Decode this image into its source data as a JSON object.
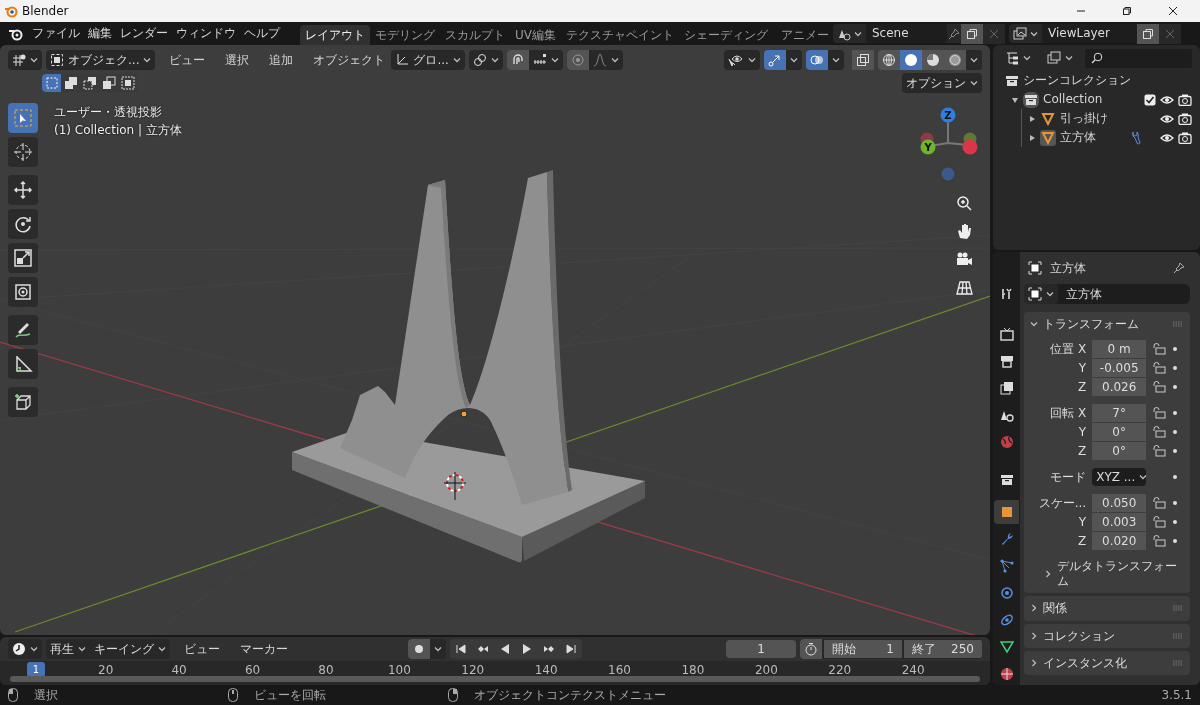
{
  "window": {
    "title": "Blender"
  },
  "menu": [
    "ファイル",
    "編集",
    "レンダー",
    "ウィンドウ",
    "ヘルプ"
  ],
  "workspaces": [
    {
      "label": "レイアウト",
      "selected": true
    },
    {
      "label": "モデリング",
      "selected": false
    },
    {
      "label": "スカルプト",
      "selected": false
    },
    {
      "label": "UV編集",
      "selected": false
    },
    {
      "label": "テクスチャペイント",
      "selected": false
    },
    {
      "label": "シェーディング",
      "selected": false
    },
    {
      "label": "アニメー",
      "selected": false
    }
  ],
  "scene": "Scene",
  "view_layer": "ViewLayer",
  "viewport": {
    "mode": "オブジェク...",
    "menus": [
      "ビュー",
      "選択",
      "追加",
      "オブジェクト"
    ],
    "orientation": "グロ...",
    "gizmos_on": true,
    "overlays_on": true,
    "shading": [
      {
        "kind": "wire",
        "selected": false
      },
      {
        "kind": "solid",
        "selected": true
      },
      {
        "kind": "material",
        "selected": false
      },
      {
        "kind": "rendered",
        "selected": false
      }
    ],
    "select_modes": [
      {
        "kind": "new",
        "selected": true
      },
      {
        "kind": "extend",
        "selected": false
      },
      {
        "kind": "subtract",
        "selected": false
      },
      {
        "kind": "invert",
        "selected": false
      },
      {
        "kind": "intersect",
        "selected": false
      }
    ],
    "options": "オプション",
    "view_name": "ユーザー・透視投影",
    "view_info": "(1) Collection | 立方体",
    "tools": [
      [
        {
          "kind": "select",
          "selected": true
        },
        {
          "kind": "cursor",
          "selected": false
        }
      ],
      [
        {
          "kind": "move",
          "selected": false
        },
        {
          "kind": "rotate",
          "selected": false
        },
        {
          "kind": "scale",
          "selected": false
        },
        {
          "kind": "transform",
          "selected": false
        }
      ],
      [
        {
          "kind": "annotate",
          "selected": false
        },
        {
          "kind": "measure",
          "selected": false
        }
      ],
      [
        {
          "kind": "add_cube",
          "selected": false
        }
      ]
    ],
    "gizmo": {
      "z": "Z",
      "y": "Y"
    }
  },
  "outliner": {
    "root": "シーンコレクション",
    "collection": {
      "label": "Collection",
      "expanded": true,
      "checked": true,
      "active": true,
      "children": [
        {
          "label": "引っ掛け",
          "expanded": false,
          "selected": false,
          "modifier": false
        },
        {
          "label": "立方体",
          "expanded": false,
          "selected": true,
          "modifier": true
        }
      ]
    }
  },
  "properties": {
    "tabs": [
      [
        {
          "kind": "tool",
          "selected": false
        }
      ],
      [
        {
          "kind": "render",
          "selected": false
        },
        {
          "kind": "output",
          "selected": false
        },
        {
          "kind": "view_layer",
          "selected": false
        },
        {
          "kind": "scene",
          "selected": false
        },
        {
          "kind": "world",
          "selected": false
        }
      ],
      [
        {
          "kind": "collection",
          "selected": false
        }
      ],
      [
        {
          "kind": "object",
          "selected": true
        },
        {
          "kind": "modifier",
          "selected": false
        },
        {
          "kind": "particles",
          "selected": false
        },
        {
          "kind": "physics",
          "selected": false
        },
        {
          "kind": "constraints",
          "selected": false
        },
        {
          "kind": "data",
          "selected": false
        },
        {
          "kind": "material",
          "selected": false
        }
      ]
    ],
    "object": "立方体",
    "name": "立方体",
    "transform": {
      "title": "トランスフォーム",
      "expanded": true,
      "groups": [
        [
          {
            "kind": "number",
            "label": "位置 X",
            "value": "0 m"
          },
          {
            "kind": "number",
            "label": "Y",
            "value": "-0.005"
          },
          {
            "kind": "number",
            "label": "Z",
            "value": "0.026"
          }
        ],
        [
          {
            "kind": "number",
            "label": "回転 X",
            "value": "7°"
          },
          {
            "kind": "number",
            "label": "Y",
            "value": "0°"
          },
          {
            "kind": "number",
            "label": "Z",
            "value": "0°"
          }
        ],
        [
          {
            "kind": "dropdown",
            "label": "モード",
            "value": "XYZ ..."
          }
        ],
        [
          {
            "kind": "number",
            "label": "スケー...",
            "value": "0.050"
          },
          {
            "kind": "number",
            "label": "Y",
            "value": "0.003"
          },
          {
            "kind": "number",
            "label": "Z",
            "value": "0.020"
          }
        ]
      ],
      "sub": {
        "title": "デルタトランスフォーム",
        "expanded": false
      }
    },
    "panels": [
      {
        "title": "関係",
        "expanded": false
      },
      {
        "title": "コレクション",
        "expanded": false
      },
      {
        "title": "インスタンス化",
        "expanded": false
      }
    ]
  },
  "timeline": {
    "menus": [
      {
        "label": "再生",
        "dropdown": true
      },
      {
        "label": "キーイング",
        "dropdown": true
      },
      {
        "label": "ビュー",
        "dropdown": false
      },
      {
        "label": "マーカー",
        "dropdown": false
      }
    ],
    "current_frame": "1",
    "start_label": "開始",
    "start": "1",
    "end_label": "終了",
    "end": "250",
    "playhead": "1",
    "ruler": [
      "20",
      "40",
      "60",
      "80",
      "100",
      "120",
      "140",
      "160",
      "180",
      "200",
      "220",
      "240"
    ]
  },
  "status": {
    "items": [
      {
        "kind": "left_click",
        "text": "選択"
      },
      {
        "kind": "middle_click",
        "text": "ビューを回転"
      },
      {
        "kind": "right_click",
        "text": "オブジェクトコンテクストメニュー"
      }
    ],
    "version": "3.5.1"
  }
}
